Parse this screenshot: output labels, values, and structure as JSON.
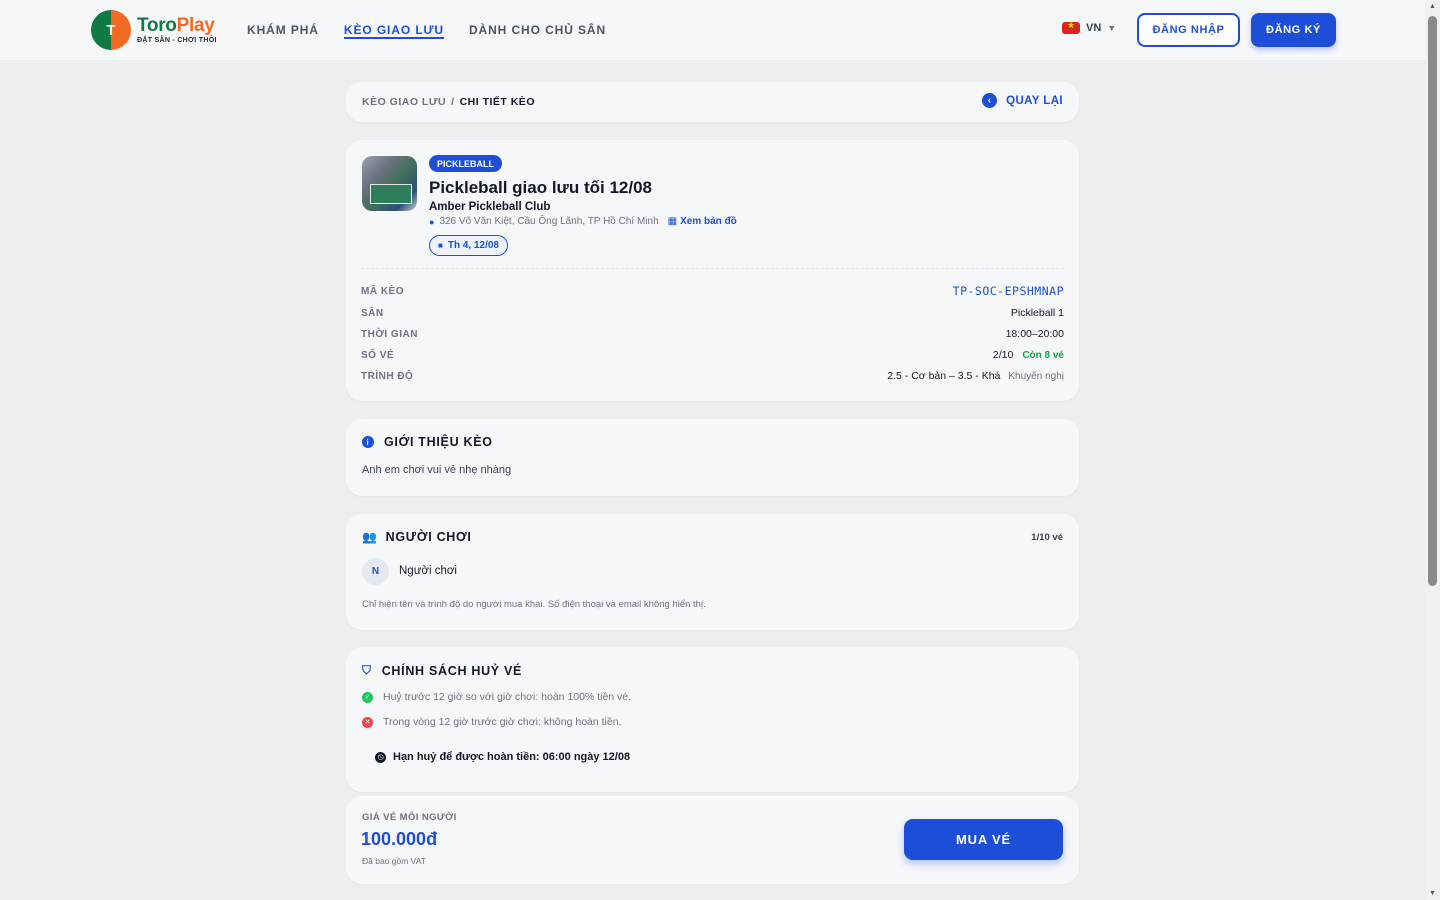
{
  "brand": {
    "mark": "T",
    "name_a": "Toro",
    "name_b": "Play",
    "tagline": "ĐẶT SÂN - CHƠI THÔI"
  },
  "nav": [
    {
      "label": "KHÁM PHÁ"
    },
    {
      "label": "KÈO GIAO LƯU",
      "active": true
    },
    {
      "label": "DÀNH CHO CHỦ SÂN"
    }
  ],
  "language": {
    "code": "VN"
  },
  "auth": {
    "login": "ĐĂNG NHẬP",
    "register": "ĐĂNG KÝ"
  },
  "breadcrumb": {
    "parent": "KÈO GIAO LƯU",
    "separator": "/",
    "current": "CHI TIẾT KÈO",
    "back": "QUAY LẠI"
  },
  "event": {
    "sport": "PICKLEBALL",
    "title": "Pickleball giao lưu tối 12/08",
    "club": "Amber Pickleball Club",
    "address": "326 Võ Văn Kiệt, Cầu Ông Lãnh, TP Hồ Chí Minh",
    "map_link": "Xem bản đồ",
    "date": "Th 4, 12/08"
  },
  "details": {
    "code_label": "MÃ KÈO",
    "code": "TP-SOC-EPSHMNAP",
    "court_label": "SÂN",
    "court": "Pickleball 1",
    "time_label": "THỜI GIAN",
    "time": "18:00–20:00",
    "tickets_label": "SỐ VÉ",
    "tickets": "2/10",
    "tickets_left": "Còn 8 vé",
    "level_label": "TRÌNH ĐỘ",
    "level": "2.5 - Cơ bản – 3.5 - Khá",
    "level_note": "Khuyến nghị"
  },
  "intro": {
    "title": "GIỚI THIỆU KÈO",
    "text": "Anh em chơi vui vẻ nhẹ nhàng"
  },
  "players": {
    "title": "NGƯỜI CHƠI",
    "count": "1/10 vé",
    "list": [
      {
        "initial": "N",
        "name": "Người chơi"
      }
    ],
    "note": "Chỉ hiện tên và trình độ do người mua khai. Số điện thoại và email không hiển thị."
  },
  "policy": {
    "title": "CHÍNH SÁCH HUỶ VÉ",
    "refund_rule": "Huỷ trước 12 giờ so với giờ chơi: hoàn 100% tiền vé.",
    "no_refund_rule": "Trong vòng 12 giờ trước giờ chơi: không hoàn tiền.",
    "deadline": "Hạn huỷ để được hoàn tiền: 06:00 ngày 12/08"
  },
  "purchase": {
    "price_label": "GIÁ VÉ MỖI NGƯỜI",
    "price": "100.000đ",
    "vat_note": "Đã bao gồm VAT",
    "buy": "MUA VÉ"
  },
  "colors": {
    "primary": "#1d4ed8",
    "success": "#16a34a",
    "danger": "#ef4444",
    "brand_green": "#0f7a43",
    "brand_orange": "#f26a21"
  }
}
